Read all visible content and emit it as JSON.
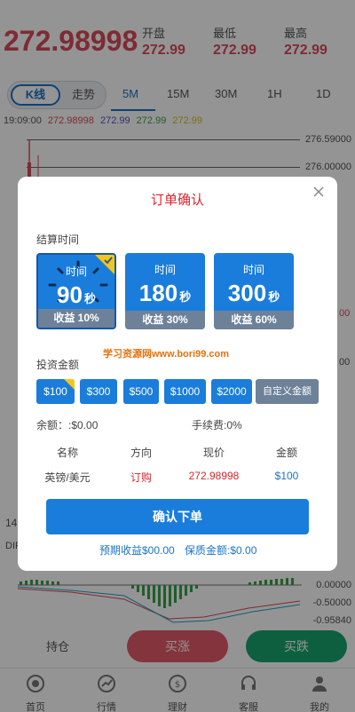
{
  "ticker": {
    "price": "272.98998",
    "open_label": "开盘",
    "open_value": "272.99",
    "low_label": "最低",
    "low_value": "272.99",
    "high_label": "最高",
    "high_value": "272.99"
  },
  "chart_tabs": {
    "segment": [
      "K线",
      "走势"
    ],
    "timeframes": [
      "5M",
      "15M",
      "30M",
      "1H",
      "1D"
    ],
    "active_timeframe": "5M"
  },
  "legend": {
    "time": "19:09:00",
    "values": [
      {
        "text": "272.98998",
        "color": "#d94a5a"
      },
      {
        "text": "272.99",
        "color": "#4a56c8"
      },
      {
        "text": "272.99",
        "color": "#3aa04a"
      },
      {
        "text": "272.99",
        "color": "#d6c21a"
      }
    ]
  },
  "axis": {
    "main": [
      "276.59000",
      "276.00000"
    ],
    "macd": [
      "0.00000",
      "-0.50000",
      "-0.95840"
    ]
  },
  "partial_labels": {
    "left_num": "14",
    "left_dif": "DIF",
    "right_a": "00",
    "right_b": "00"
  },
  "actions": {
    "hold": "持仓",
    "buy_rise": "买涨",
    "buy_fall": "买跌"
  },
  "tabbar": [
    {
      "label": "首页",
      "icon": "home-icon"
    },
    {
      "label": "行情",
      "icon": "chart-icon"
    },
    {
      "label": "理财",
      "icon": "coin-icon"
    },
    {
      "label": "客服",
      "icon": "headset-icon"
    },
    {
      "label": "我的",
      "icon": "user-icon"
    }
  ],
  "modal": {
    "title": "订单确认",
    "settle_label": "结算时间",
    "cards": [
      {
        "time_label": "时间",
        "value": "90",
        "unit": "秒",
        "profit": "收益 10%",
        "selected": true
      },
      {
        "time_label": "时间",
        "value": "180",
        "unit": "秒",
        "profit": "收益 30%",
        "selected": false
      },
      {
        "time_label": "时间",
        "value": "300",
        "unit": "秒",
        "profit": "收益 60%",
        "selected": false
      }
    ],
    "watermark": "学习资源网www.bori99.com",
    "invest_label": "投资金额",
    "amounts": [
      "$100",
      "$300",
      "$500",
      "$1000",
      "$2000",
      "自定义金额"
    ],
    "selected_amount": "$100",
    "balance": "余额：:$0.00",
    "fee": "手续费:0%",
    "order_headers": [
      "名称",
      "方向",
      "现价",
      "金额"
    ],
    "order_values": [
      "英镑/美元",
      "订购",
      "272.98998",
      "$100"
    ],
    "confirm_label": "确认下单",
    "expected_profit": "预期收益$00.00",
    "guarantee": "保质金额:$0.00"
  },
  "colors": {
    "accent": "#1a7ddb",
    "rise": "#e25a68",
    "fall": "#19a46e",
    "title": "#d9252e"
  }
}
